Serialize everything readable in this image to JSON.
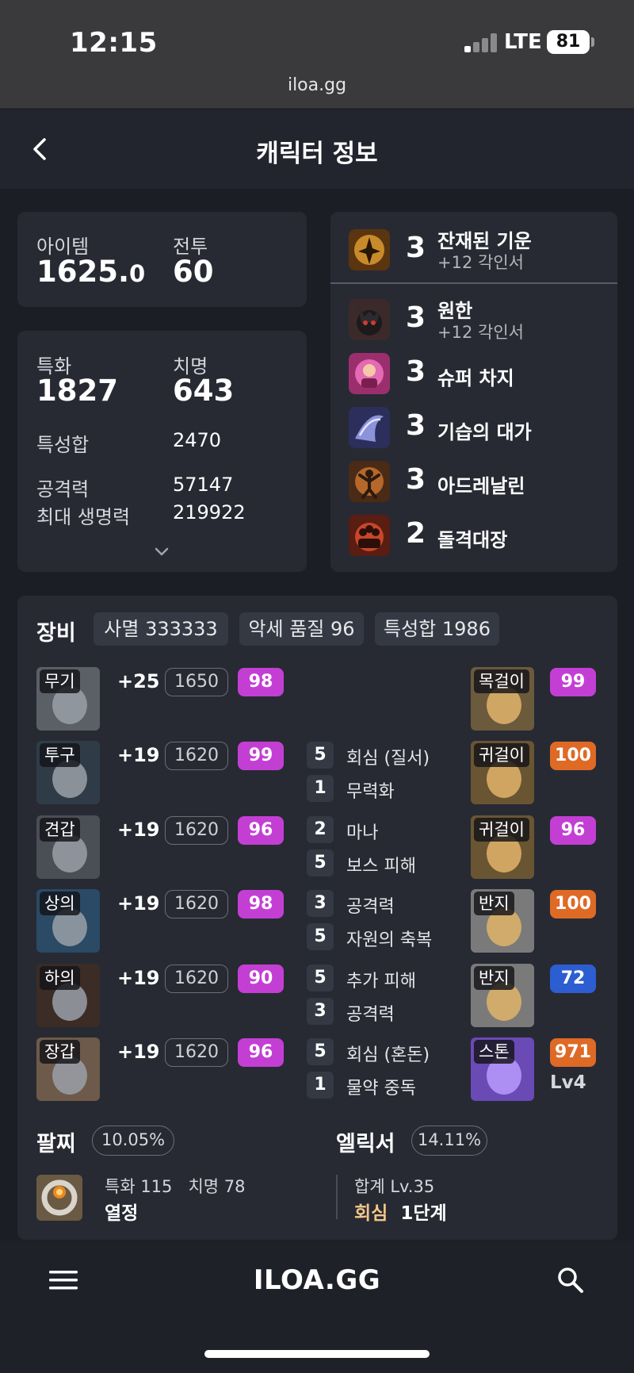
{
  "status_bar": {
    "time": "12:15",
    "network": "LTE",
    "battery": "81"
  },
  "browser": {
    "url": "iloa.gg"
  },
  "header": {
    "title": "캐릭터 정보"
  },
  "summary": {
    "item_label": "아이템",
    "item_level_main": "1625.",
    "item_level_dec": "0",
    "combat_label": "전투",
    "combat_level": "60"
  },
  "stats": {
    "spec_label": "특화",
    "spec_value": "1827",
    "crit_label": "치명",
    "crit_value": "643",
    "trait_total_label": "특성합",
    "trait_total_value": "2470",
    "attack_label": "공격력",
    "attack_value": "57147",
    "hp_label": "최대 생명력",
    "hp_value": "219922"
  },
  "engravings": [
    {
      "level": "3",
      "name": "잔재된 기운",
      "sub": "+12 각인서",
      "icon": "shadow-hunter-icon"
    },
    {
      "level": "3",
      "name": "원한",
      "sub": "+12 각인서",
      "icon": "grudge-demon-icon"
    },
    {
      "level": "3",
      "name": "슈퍼 차지",
      "sub": "",
      "icon": "super-charge-icon"
    },
    {
      "level": "3",
      "name": "기습의 대가",
      "sub": "",
      "icon": "ambush-master-icon"
    },
    {
      "level": "3",
      "name": "아드레날린",
      "sub": "",
      "icon": "adrenaline-icon"
    },
    {
      "level": "2",
      "name": "돌격대장",
      "sub": "",
      "icon": "raid-captain-icon"
    }
  ],
  "equipment": {
    "title": "장비",
    "tags": [
      "사멸 333333",
      "악세 품질 96",
      "특성합 1986"
    ],
    "armor": [
      {
        "slot": "무기",
        "enhance": "+25",
        "ilvl": "1650",
        "quality": "98",
        "quality_color": "#c33fd4"
      },
      {
        "slot": "투구",
        "enhance": "+19",
        "ilvl": "1620",
        "quality": "99",
        "quality_color": "#c33fd4"
      },
      {
        "slot": "견갑",
        "enhance": "+19",
        "ilvl": "1620",
        "quality": "96",
        "quality_color": "#c33fd4"
      },
      {
        "slot": "상의",
        "enhance": "+19",
        "ilvl": "1620",
        "quality": "98",
        "quality_color": "#c33fd4"
      },
      {
        "slot": "하의",
        "enhance": "+19",
        "ilvl": "1620",
        "quality": "90",
        "quality_color": "#c33fd4"
      },
      {
        "slot": "장갑",
        "enhance": "+19",
        "ilvl": "1620",
        "quality": "96",
        "quality_color": "#c33fd4"
      }
    ],
    "effects": [
      {
        "level": "5",
        "name": "회심 (질서)"
      },
      {
        "level": "1",
        "name": "무력화"
      },
      {
        "level": "2",
        "name": "마나"
      },
      {
        "level": "5",
        "name": "보스 피해"
      },
      {
        "level": "3",
        "name": "공격력"
      },
      {
        "level": "5",
        "name": "자원의 축복"
      },
      {
        "level": "5",
        "name": "추가 피해"
      },
      {
        "level": "3",
        "name": "공격력"
      },
      {
        "level": "5",
        "name": "회심 (혼돈)"
      },
      {
        "level": "1",
        "name": "물약 중독"
      }
    ],
    "accessories": [
      {
        "slot": "목걸이",
        "quality": "99",
        "quality_color": "#c33fd4"
      },
      {
        "slot": "귀걸이",
        "quality": "100",
        "quality_color": "#de6a26"
      },
      {
        "slot": "귀걸이",
        "quality": "96",
        "quality_color": "#c33fd4"
      },
      {
        "slot": "반지",
        "quality": "100",
        "quality_color": "#de6a26"
      },
      {
        "slot": "반지",
        "quality": "72",
        "quality_color": "#2c5ed1"
      },
      {
        "slot": "스톤",
        "quality": "971",
        "quality_color": "#de6a26",
        "extra": "Lv4"
      }
    ]
  },
  "bracelet": {
    "title": "팔찌",
    "percent": "10.05%",
    "stat1": "특화 115",
    "stat2": "치명 78",
    "effect": "열정"
  },
  "elixir": {
    "title": "엘릭서",
    "percent": "14.11%",
    "total": "합계 Lv.35",
    "effect_name": "회심",
    "effect_level": "1단계"
  },
  "bottom_nav": {
    "logo": "ILOA.GG"
  }
}
